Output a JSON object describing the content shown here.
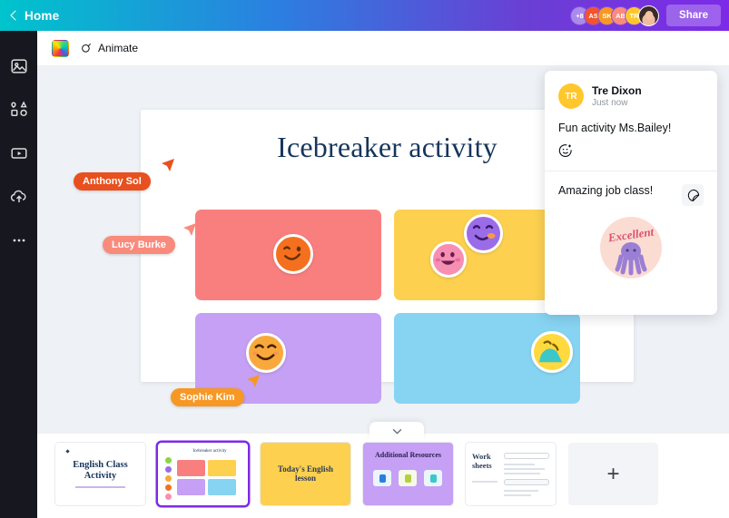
{
  "topbar": {
    "home_label": "Home",
    "share_label": "Share",
    "collaborators": [
      {
        "initials": "+8",
        "color": "#a98bea"
      },
      {
        "initials": "AS",
        "color": "#f2542d"
      },
      {
        "initials": "SK",
        "color": "#f79824"
      },
      {
        "initials": "AB",
        "color": "#f98b7d"
      },
      {
        "initials": "TR",
        "color": "#ffc72c"
      }
    ],
    "photo_avatar_name": "user-photo-avatar",
    "gradient_start": "#00c4cc",
    "gradient_end": "#7d2ae8"
  },
  "rail": {
    "items": [
      {
        "name": "images-icon",
        "label": "Images"
      },
      {
        "name": "elements-icon",
        "label": "Elements"
      },
      {
        "name": "video-icon",
        "label": "Videos"
      },
      {
        "name": "uploads-icon",
        "label": "Uploads"
      },
      {
        "name": "more-icon",
        "label": "More"
      }
    ]
  },
  "toolbar": {
    "color_swatch_label": "Page color",
    "animate_label": "Animate"
  },
  "canvas": {
    "page_title": "Icebreaker activity",
    "cells": [
      {
        "name": "cell-pink",
        "color": "#f97f7f"
      },
      {
        "name": "cell-yellow",
        "color": "#fdd14f"
      },
      {
        "name": "cell-purple",
        "color": "#c5a0f5"
      },
      {
        "name": "cell-blue",
        "color": "#87d4f2"
      }
    ],
    "stickers": [
      {
        "name": "sticker-wink-orange",
        "color": "#f4701f"
      },
      {
        "name": "sticker-laugh-pink",
        "color": "#f78fb3"
      },
      {
        "name": "sticker-smile-purple",
        "color": "#9b6ce8"
      },
      {
        "name": "sticker-smile-orange",
        "color": "#f9a93c"
      },
      {
        "name": "sticker-yellow-hidden",
        "color": "#ffd93d"
      }
    ],
    "collaborators": [
      {
        "name": "Anthony Sol",
        "color": "#e8501f"
      },
      {
        "name": "Lucy Burke",
        "color": "#f98b7d"
      },
      {
        "name": "Sophie Kim",
        "color": "#f79824"
      }
    ]
  },
  "comments": {
    "author_initials": "TR",
    "author_name": "Tre Dixon",
    "timestamp": "Just now",
    "message_1": "Fun activity Ms.Bailey!",
    "message_2": "Amazing job class!",
    "sticker_word": "Excellent",
    "add_reaction_label": "add-reaction",
    "sticker_button_label": "add-sticker"
  },
  "strip": {
    "collapse_label": "collapse-pages",
    "add_page_label": "+",
    "thumbnails": [
      {
        "title": "English Class Activity",
        "subtitle": "",
        "type": "title-page",
        "selected": false
      },
      {
        "title": "Icebreaker activity",
        "subtitle": "",
        "type": "grid-page",
        "selected": true
      },
      {
        "title": "Today's English lesson",
        "subtitle": "",
        "type": "yellow-page",
        "selected": false
      },
      {
        "title": "Additional Resources",
        "subtitle": "",
        "type": "resources-page",
        "selected": false
      },
      {
        "title": "Work sheets",
        "subtitle": "",
        "type": "worksheet-page",
        "selected": false
      }
    ]
  }
}
